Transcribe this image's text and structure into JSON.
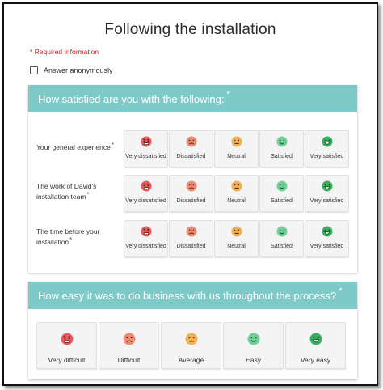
{
  "page": {
    "title": "Following the installation",
    "required_note": "* Required Information",
    "anonymous_label": "Answer anonymously"
  },
  "satisfaction": {
    "header": "How satisfied are you with the following:",
    "required_mark": "*",
    "options": [
      "Very dissatisfied",
      "Dissatisfied",
      "Neutral",
      "Satisfied",
      "Very satisfied"
    ],
    "rows": [
      {
        "label": "Your general experience",
        "required": "*"
      },
      {
        "label": "The work of David's installation team",
        "required": "*"
      },
      {
        "label": "The time before your installation",
        "required": "*"
      }
    ]
  },
  "ease": {
    "header": "How easy it was to do business with us throughout the process?",
    "required_mark": "*",
    "options": [
      "Very difficult",
      "Difficult",
      "Average",
      "Easy",
      "Very easy"
    ]
  },
  "colors": {
    "header_bg": "#7ecac9",
    "required": "#d0202a",
    "face_very_negative": "#e8595e",
    "face_negative": "#ef8a72",
    "face_neutral": "#f2b155",
    "face_positive": "#6fcf97",
    "face_very_positive": "#3aae5e"
  },
  "icons": [
    "very-angry-face-icon",
    "sad-face-icon",
    "neutral-face-icon",
    "smile-face-icon",
    "big-smile-face-icon"
  ]
}
